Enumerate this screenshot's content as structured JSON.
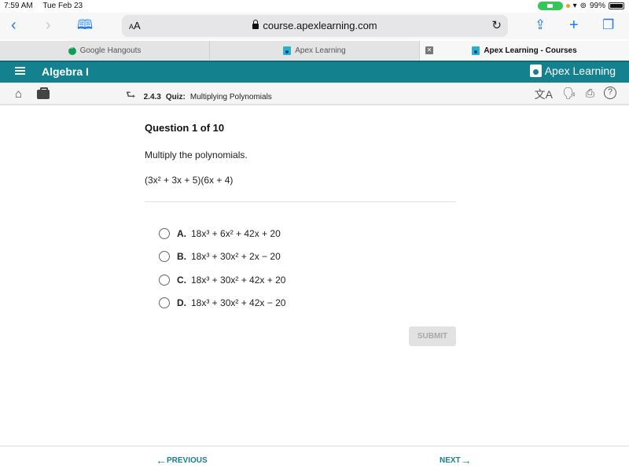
{
  "statusbar": {
    "time": "7:59 AM",
    "date": "Tue Feb 23",
    "battery": "99%"
  },
  "browser": {
    "aa_label": "AA",
    "url": "course.apexlearning.com",
    "tabs": [
      {
        "label": "Google Hangouts",
        "icon": "hangouts-icon"
      },
      {
        "label": "Apex Learning",
        "icon": "apex-favicon"
      },
      {
        "label": "Apex Learning - Courses",
        "icon": "apex-favicon",
        "active": true
      }
    ]
  },
  "app": {
    "title": "Algebra I",
    "logo": "Apex Learning"
  },
  "breadcrumb": {
    "number": "2.4.3",
    "type": "Quiz:",
    "name": "Multiplying Polynomials"
  },
  "question": {
    "header": "Question 1 of 10",
    "prompt": "Multiply the polynomials.",
    "expression": "(3x² + 3x + 5)(6x + 4)",
    "options": [
      {
        "letter": "A.",
        "text": "18x³ + 6x² + 42x + 20"
      },
      {
        "letter": "B.",
        "text": "18x³ + 30x² + 2x − 20"
      },
      {
        "letter": "C.",
        "text": "18x³ + 30x² + 42x + 20"
      },
      {
        "letter": "D.",
        "text": "18x³ + 30x² + 42x − 20"
      }
    ]
  },
  "actions": {
    "submit": "SUBMIT",
    "previous": "PREVIOUS",
    "next": "NEXT"
  }
}
